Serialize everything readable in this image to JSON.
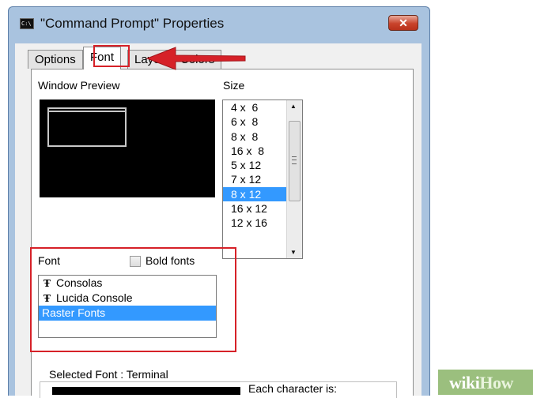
{
  "window": {
    "title": "\"Command Prompt\" Properties",
    "icon_text": "C:\\",
    "close_label": "✕"
  },
  "tabs": [
    {
      "label": "Options",
      "active": false
    },
    {
      "label": "Font",
      "active": true
    },
    {
      "label": "Layout",
      "active": false
    },
    {
      "label": "Colors",
      "active": false
    }
  ],
  "preview": {
    "label": "Window Preview"
  },
  "size": {
    "label": "Size",
    "items": [
      "4 x  6",
      "6 x  8",
      "8 x  8",
      "16 x  8",
      "5 x 12",
      "7 x 12",
      "8 x 12",
      "16 x 12",
      "12 x 16"
    ],
    "selected": "8 x 12"
  },
  "font": {
    "label": "Font",
    "bold_label": "Bold fonts",
    "bold_checked": false,
    "items": [
      "Consolas",
      "Lucida Console",
      "Raster Fonts"
    ],
    "selected": "Raster Fonts"
  },
  "selected_font": {
    "label": "Selected Font : Terminal",
    "each_char": "Each character is:"
  },
  "watermark": {
    "wiki": "wiki",
    "how": "How"
  },
  "colors": {
    "highlight": "#d62128",
    "selection": "#3399ff",
    "arrow": "#d62128"
  }
}
